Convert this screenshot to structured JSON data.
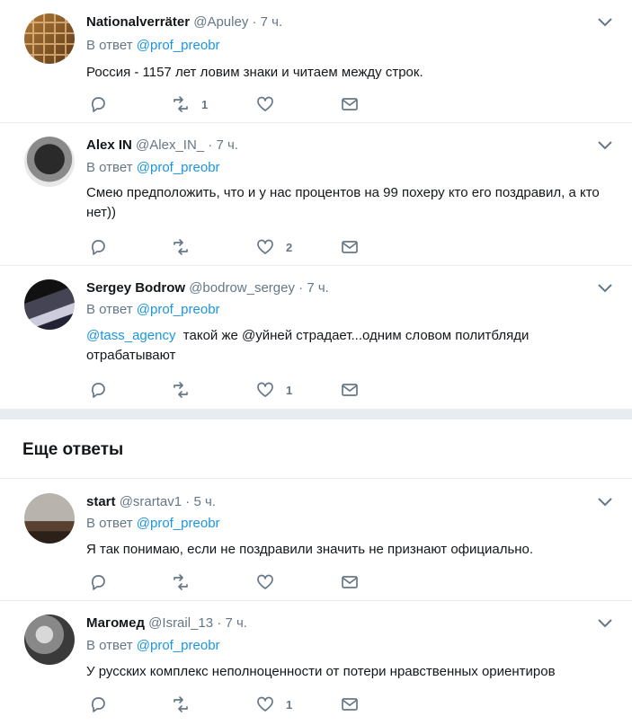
{
  "tweets": [
    {
      "name": "Nationalverräter",
      "handle": "@Apuley",
      "time": "7 ч.",
      "reply_prefix": "В ответ",
      "reply_to": "@prof_preobr",
      "text": "Россия - 1157 лет ловим знаки и читаем между строк.",
      "retweets": "1",
      "likes": ""
    },
    {
      "name": "Alex IN",
      "handle": "@Alex_IN_",
      "time": "7 ч.",
      "reply_prefix": "В ответ",
      "reply_to": "@prof_preobr",
      "text": "Смею предположить, что и у нас процентов на 99 похеру кто его поздравил, а кто нет))",
      "retweets": "",
      "likes": "2"
    },
    {
      "name": "Sergey Bodrow",
      "handle": "@bodrow_sergey",
      "time": "7 ч.",
      "reply_prefix": "В ответ",
      "reply_to": "@prof_preobr",
      "text_mention": "@tass_agency",
      "text": "такой же @уйней страдает...одним словом политбляди отрабатывают",
      "retweets": "",
      "likes": "1"
    },
    {
      "name": "start",
      "handle": "@srartav1",
      "time": "5 ч.",
      "reply_prefix": "В ответ",
      "reply_to": "@prof_preobr",
      "text": "Я так понимаю, если не поздравили значить не признают официально.",
      "retweets": "",
      "likes": ""
    },
    {
      "name": "Магомед",
      "handle": "@Israil_13",
      "time": "7 ч.",
      "reply_prefix": "В ответ",
      "reply_to": "@prof_preobr",
      "text": "У русских комплекс неполноценности от потери нравственных ориентиров",
      "retweets": "",
      "likes": "1"
    }
  ],
  "more_replies_heading": "Еще ответы",
  "dot": "·",
  "colors": {
    "link": "#1b95e0",
    "secondary": "#657786",
    "border": "#e6ecf0"
  }
}
